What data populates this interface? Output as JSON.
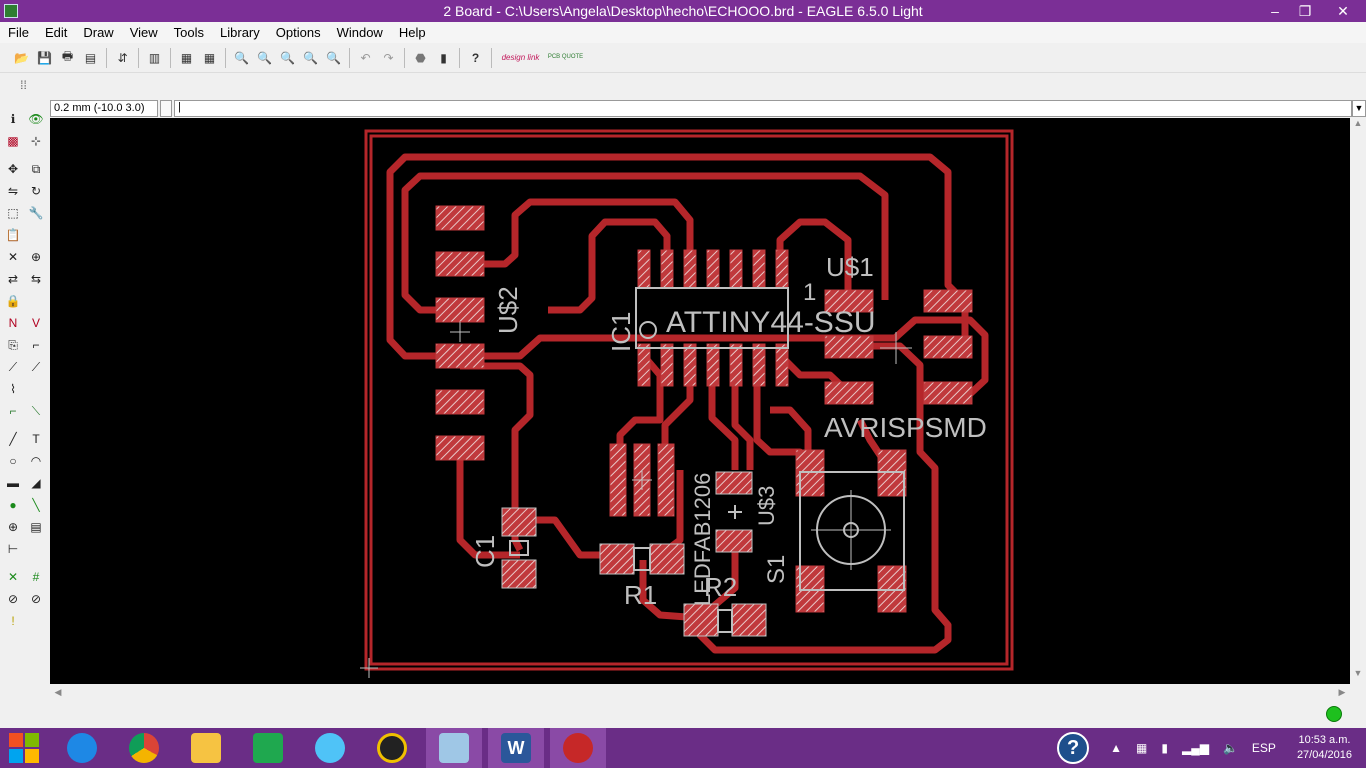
{
  "window": {
    "title": "2 Board - C:\\Users\\Angela\\Desktop\\hecho\\ECHOOO.brd - EAGLE 6.5.0 Light",
    "controls": [
      "–",
      "❐",
      "✕"
    ]
  },
  "menu": [
    "File",
    "Edit",
    "Draw",
    "View",
    "Tools",
    "Library",
    "Options",
    "Window",
    "Help"
  ],
  "toolbar": {
    "icons": [
      "open-icon",
      "save-icon",
      "print-icon",
      "cam-icon",
      "sep",
      "script-icon",
      "sep",
      "library-icon",
      "sep",
      "scr-icon",
      "ulp-icon",
      "sep",
      "zoom-fit-icon",
      "zoom-in-icon",
      "zoom-out-icon",
      "zoom-redraw-icon",
      "zoom-select-icon",
      "sep",
      "undo-icon",
      "redo-icon",
      "sep",
      "stop-icon",
      "go-icon",
      "sep",
      "help-icon",
      "sep",
      "designlink-icon",
      "pcb-quote-icon"
    ],
    "designlink_label": "design link",
    "pcbquote_label": "PCB QUOTE"
  },
  "command": {
    "coordinate": "0.2 mm (-10.0 3.0)",
    "value": "|"
  },
  "palette": [
    [
      "info-icon",
      "show-icon"
    ],
    [
      "display-icon",
      "mark-icon"
    ],
    [
      "gap"
    ],
    [
      "move-icon",
      "copy-icon"
    ],
    [
      "mirror-icon",
      "rotate-icon"
    ],
    [
      "group-icon",
      "change-icon"
    ],
    [
      "paste-icon"
    ],
    [
      "delete-icon",
      "add-icon"
    ],
    [
      "pinswap-icon",
      "replace-icon"
    ],
    [
      "lock-icon"
    ],
    [
      "name-icon",
      "value-icon"
    ],
    [
      "smash-icon",
      "miter-icon"
    ],
    [
      "split-icon",
      "optimize-icon"
    ],
    [
      "meander-icon"
    ],
    [
      "route-icon",
      "ripup-icon"
    ],
    [
      "gap"
    ],
    [
      "wire-icon",
      "text-icon"
    ],
    [
      "circle-icon",
      "arc-icon"
    ],
    [
      "rect-icon",
      "polygon-icon"
    ],
    [
      "via-icon",
      "signal-icon"
    ],
    [
      "hole-icon",
      "attribute-icon"
    ],
    [
      "dimension-icon"
    ],
    [
      "gap"
    ],
    [
      "ratsnest-icon",
      "autorouter-icon"
    ],
    [
      "erc-icon",
      "drc-icon"
    ],
    [
      "errors-icon"
    ]
  ],
  "board": {
    "labels": {
      "ic1": "IC1",
      "attiny": "ATTINY44-SSU",
      "pin1": "1",
      "us1": "U$1",
      "us2": "U$2",
      "us3": "U$3",
      "avr": "AVRISPSMD",
      "c1": "C1",
      "r1": "R1",
      "r2": "R2",
      "led": "LEDFAB1206",
      "s1": "S1"
    }
  },
  "taskbar": {
    "apps": [
      "start-icon",
      "ie-icon",
      "chrome-icon",
      "explorer-icon",
      "store-icon",
      "rocket-icon",
      "media-icon",
      "notes-icon",
      "word-icon",
      "eagle-icon"
    ],
    "language": "ESP",
    "time": "10:53 a.m.",
    "date": "27/04/2016"
  },
  "colors": {
    "titlebar": "#7b2f96",
    "taskbar": "#6a2d86",
    "trace": "#b5262a",
    "pad": "#c0393c",
    "silk": "#bfbfbf"
  }
}
